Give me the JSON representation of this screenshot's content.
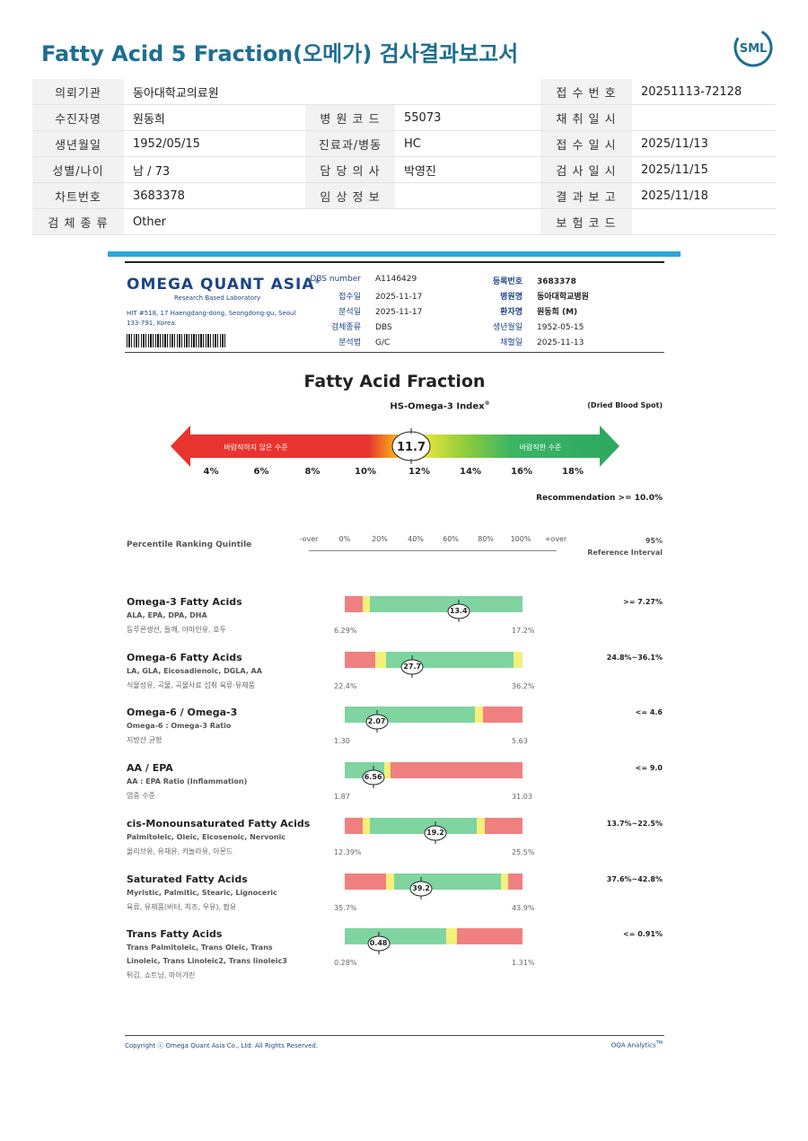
{
  "header": {
    "title": "Fatty Acid 5 Fraction(오메가) 검사결과보고서",
    "logo_text": "SML"
  },
  "info_table": [
    {
      "l1": "의뢰기관",
      "v1": "동아대학교의료원",
      "l2": "",
      "v2": "",
      "l3": "접 수 번 호",
      "v3": "20251113-72128"
    },
    {
      "l1": "수진자명",
      "v1": "원동희",
      "l2": "병 원 코 드",
      "v2": "55073",
      "l3": "채 취 일 시",
      "v3": ""
    },
    {
      "l1": "생년월일",
      "v1": "1952/05/15",
      "l2": "진료과/병동",
      "v2": "HC",
      "l3": "접 수 일 시",
      "v3": "2025/11/13"
    },
    {
      "l1": "성별/나이",
      "v1": "남 / 73",
      "l2": "담 당 의 사",
      "v2": "박영진",
      "l3": "검 사 일 시",
      "v3": "2025/11/15"
    },
    {
      "l1": "차트번호",
      "v1": "3683378",
      "l2": "임 상 정 보",
      "v2": "",
      "l3": "결 과 보 고",
      "v3": "2025/11/18"
    },
    {
      "l1": "검 체 종 류",
      "v1": "Other",
      "l2": "",
      "v2": "",
      "l3": "보 험 코 드",
      "v3": ""
    }
  ],
  "lab": {
    "logo": "OMEGA QUANT ASIA",
    "reg": "®",
    "subtitle": "Research Based Laboratory",
    "address": "HIT #518, 17 Haengdang-dong, Seongdong-gu, Seoul 133-791, Korea."
  },
  "meta_left": [
    {
      "label": "DBS number",
      "value": "A1146429"
    },
    {
      "label": "접수일",
      "value": "2025-11-17"
    },
    {
      "label": "분석일",
      "value": "2025-11-17"
    },
    {
      "label": "검체종류",
      "value": "DBS"
    },
    {
      "label": "분석법",
      "value": "G/C"
    }
  ],
  "meta_right": [
    {
      "label": "등록번호",
      "value": "3683378"
    },
    {
      "label": "병원명",
      "value": "동아대학교병원"
    },
    {
      "label": "환자명",
      "value": "원동희 (M)"
    },
    {
      "label": "생년월일",
      "value": "1952-05-15"
    },
    {
      "label": "채혈일",
      "value": "2025-11-13"
    }
  ],
  "index": {
    "title": "Fatty Acid Fraction",
    "subtitle": "HS-Omega-3 Index",
    "subtitle_reg": "®",
    "specimen": "(Dried Blood Spot)",
    "value": "11.7",
    "value_num": 11.7,
    "bad_label": "바람직하지 않은 수준",
    "good_label": "바람직한 수준",
    "ticks": [
      "4%",
      "6%",
      "8%",
      "10%",
      "12%",
      "14%",
      "16%",
      "18%"
    ],
    "recommendation": "Recommendation  >= 10.0%"
  },
  "percentile": {
    "label": "Percentile Ranking Quintile",
    "scale": [
      "-over",
      "0%",
      "20%",
      "40%",
      "60%",
      "80%",
      "100%",
      "+over"
    ],
    "ref_header": [
      "95%",
      "Reference Interval"
    ]
  },
  "colors": {
    "red": "#f08080",
    "yellow": "#f5f07a",
    "green": "#7fd4a0",
    "accent": "#1d6f92"
  },
  "results": [
    {
      "title": "Omega-3 Fatty Acids",
      "sub": "ALA, EPA, DPA, DHA",
      "kr": "등푸른생선, 들깨, 아마인유, 호두",
      "value": "13.4",
      "pos": 0.64,
      "min": "6.29%",
      "max": "17.2%",
      "ref": ">= 7.27%",
      "segs": [
        [
          "red",
          0.1
        ],
        [
          "yellow",
          0.04
        ],
        [
          "green",
          0.86
        ]
      ]
    },
    {
      "title": "Omega-6 Fatty Acids",
      "sub": "LA, GLA, Eicosadienoic, DGLA, AA",
      "kr": "식물성유, 곡물, 곡물사료 섭취 육류·유제품",
      "value": "27.7",
      "pos": 0.38,
      "min": "22.4%",
      "max": "36.2%",
      "ref": "24.8%~36.1%",
      "segs": [
        [
          "red",
          0.17
        ],
        [
          "yellow",
          0.06
        ],
        [
          "green",
          0.72
        ],
        [
          "yellow",
          0.05
        ]
      ]
    },
    {
      "title": "Omega-6 / Omega-3",
      "sub": "Omega-6 : Omega-3 Ratio",
      "kr": "지방산 균형",
      "value": "2.07",
      "pos": 0.18,
      "min": "1.30",
      "max": "5.63",
      "ref": "<= 4.6",
      "segs": [
        [
          "green",
          0.73
        ],
        [
          "yellow",
          0.05
        ],
        [
          "red",
          0.22
        ]
      ]
    },
    {
      "title": "AA / EPA",
      "sub": "AA : EPA Ratio (Inflammation)",
      "kr": "염증 수준",
      "value": "6.56",
      "pos": 0.16,
      "min": "1.87",
      "max": "31.03",
      "ref": "<= 9.0",
      "segs": [
        [
          "green",
          0.22
        ],
        [
          "yellow",
          0.04
        ],
        [
          "red",
          0.74
        ]
      ]
    },
    {
      "title": "cis-Monounsaturated Fatty Acids",
      "sub": "Palmitoleic, Oleic, Eicosenoic, Nervonic",
      "kr": "올리브유, 유채유, 카놀라유, 아몬드",
      "value": "19.2",
      "pos": 0.51,
      "min": "12.39%",
      "max": "25.5%",
      "ref": "13.7%~22.5%",
      "segs": [
        [
          "red",
          0.1
        ],
        [
          "yellow",
          0.04
        ],
        [
          "green",
          0.6
        ],
        [
          "yellow",
          0.05
        ],
        [
          "red",
          0.21
        ]
      ]
    },
    {
      "title": "Saturated Fatty Acids",
      "sub": "Myristic, Palmitic, Stearic, Lignoceric",
      "kr": "육류, 유제품(버터, 치즈, 우유), 팜유",
      "value": "39.2",
      "pos": 0.43,
      "min": "35.7%",
      "max": "43.9%",
      "ref": "37.6%~42.8%",
      "segs": [
        [
          "red",
          0.23
        ],
        [
          "yellow",
          0.05
        ],
        [
          "green",
          0.6
        ],
        [
          "yellow",
          0.04
        ],
        [
          "red",
          0.08
        ]
      ]
    },
    {
      "title": "Trans Fatty Acids",
      "sub": "Trans Palmitoleic, Trans Oleic, Trans",
      "sub2": "Linoleic, Trans Linoleic2, Trans linoleic3",
      "kr": "튀김, 쇼트닝, 마아가린",
      "value": "0.48",
      "pos": 0.19,
      "min": "0.28%",
      "max": "1.31%",
      "ref": "<= 0.91%",
      "segs": [
        [
          "green",
          0.57
        ],
        [
          "yellow",
          0.06
        ],
        [
          "red",
          0.37
        ]
      ]
    }
  ],
  "footer": {
    "copyright": "Copyright ⓒ Omega Quant Asia Co., Ltd.  All Rights Reserved.",
    "brand": "OQA Analytics",
    "brand_tm": "TM"
  }
}
